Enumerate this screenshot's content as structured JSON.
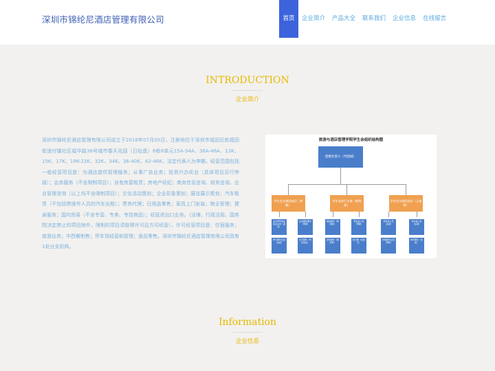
{
  "header": {
    "brand": "深圳市锦纶尼酒店管理有限公司",
    "nav": [
      {
        "label": "首页",
        "active": true
      },
      {
        "label": "企业简介"
      },
      {
        "label": "产品大全"
      },
      {
        "label": "联系我们"
      },
      {
        "label": "企业信息"
      },
      {
        "label": "在线留言"
      }
    ]
  },
  "intro": {
    "title": "INTRODUCTION",
    "subtitle": "企业简介",
    "body": "深圳市锦纶尼酒店管理有限公司成立于2018年07月05日，注册地位于深圳市福田区航福田街道付镇社区福华路38号城市春天花园（日钻盘）8栋8单元15A-34A、36A-46A、13K、15K、17K、19K-23K、32K、34K、36-40K、42-46K，法定代表人为李娜。经营范围包括一般经营项目是：为酒店提供管理服务；从事广告业务；投资兴办实业（具体项目另行申报）；会务服务（不含限制项目）；自有房屋租赁；房地产经纪；商务信息咨询、财务咨询、企业管理咨询（以上均不含限制项目）；文化活动策划；企业形象策划；展览展示策划；汽车租赁（不包括带操作人员的汽车出租）；票务代理；日用品零售；家具上门安装；物业管理；健身服务；国内贸易（不含专营、专卖、专控商品）；经营进出口业务。（法律、行政法规、国务院决定禁止的项目除外，限制的项目须取得许可后方可经营），许可经营项目是：住宿服务；旅游业务；中西餐制售；停车场经营和管理；食品零售。深圳市锦纶尼酒店管理有限公司具有1处分支机构。"
  },
  "org_chart": {
    "title": "旅游与酒店管理学院学生会组织结构图",
    "top": "团委负责人（代团城）",
    "mid": [
      "学生会主席团成员（李鹏）",
      "学生会执行主席（熊晓超）",
      "学生会主席团成员（王彬艳）"
    ],
    "leaves": [
      "主文周年选主任生主持（温涛）",
      "生活服务部长（李鹏）",
      "组织部长（熊晓超）",
      "学生会人员（李鹏）",
      "学生会人员（主席）",
      "学生会人员（主席）",
      "学习部长主任（白帆）",
      "文艺部长（代表某某）",
      "宣传部长（韩晓梦）",
      "权力部（比如王）",
      "外联部长主任（李晓）",
      "体育部长（比如）"
    ]
  },
  "info": {
    "title": "Information",
    "subtitle": "企业信息"
  }
}
